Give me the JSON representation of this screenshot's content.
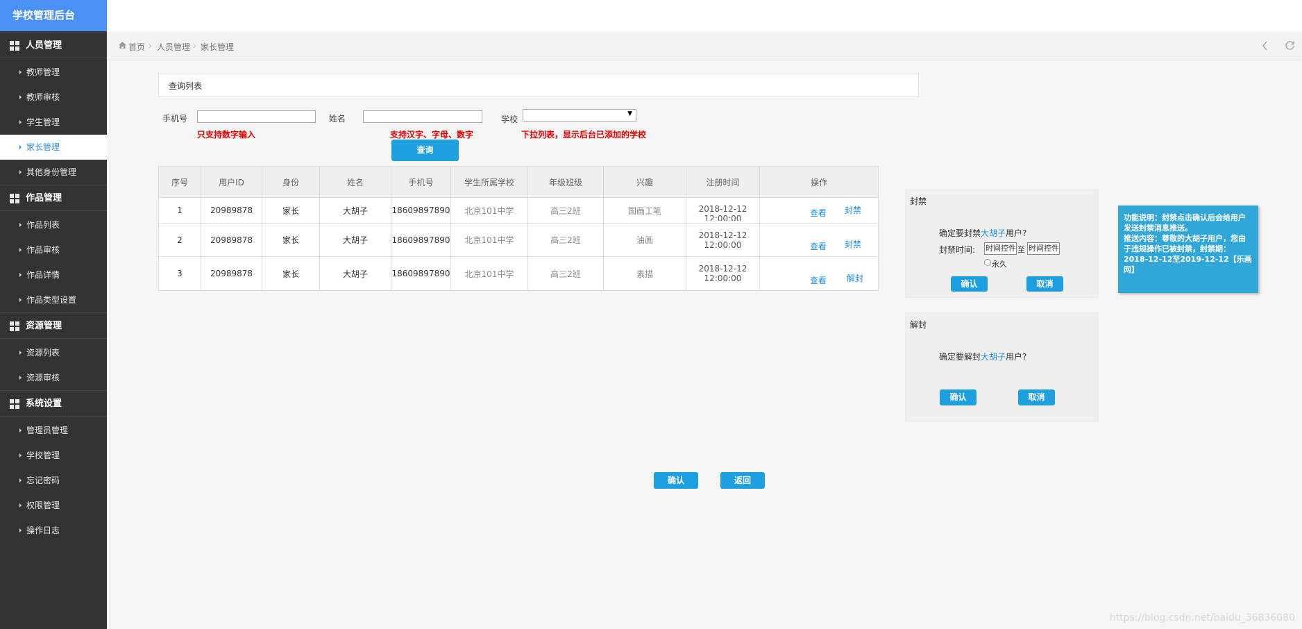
{
  "brand": "学校管理后台",
  "sidebar": {
    "groups": [
      {
        "label": "人员管理",
        "items": [
          "教师管理",
          "教师审核",
          "学生管理",
          "家长管理",
          "其他身份管理"
        ]
      },
      {
        "label": "作品管理",
        "items": [
          "作品列表",
          "作品审核",
          "作品详情",
          "作品类型设置"
        ]
      },
      {
        "label": "资源管理",
        "items": [
          "资源列表",
          "资源审核"
        ]
      },
      {
        "label": "系统设置",
        "items": [
          "管理员管理",
          "学校管理",
          "忘记密码",
          "权限管理",
          "操作日志"
        ]
      }
    ],
    "active_item": "家长管理"
  },
  "breadcrumb": {
    "home": "首页",
    "level1": "人员管理",
    "level2": "家长管理"
  },
  "query": {
    "title": "查询列表",
    "phone_label": "手机号",
    "name_label": "姓名",
    "school_label": "学校",
    "phone_hint": "只支持数字输入",
    "name_hint": "支持汉字、字母、数字",
    "school_hint": "下拉列表，显示后台已添加的学校",
    "search_button": "查询"
  },
  "table": {
    "headers": [
      "序号",
      "用户ID",
      "身份",
      "姓名",
      "手机号",
      "学生所属学校",
      "年级班级",
      "兴趣",
      "注册时间",
      "操作"
    ],
    "rows": [
      {
        "no": "1",
        "uid": "20989878",
        "role": "家长",
        "name": "大胡子",
        "phone": "18609897890",
        "school": "北京101中学",
        "grade": "高三2班",
        "hobby": "国画工笔",
        "date": "2018-12-12",
        "time": "12:00:00",
        "view": "查看",
        "action": "封禁"
      },
      {
        "no": "2",
        "uid": "20989878",
        "role": "家长",
        "name": "大胡子",
        "phone": "18609897890",
        "school": "北京101中学",
        "grade": "高三2班",
        "hobby": "油画",
        "date": "2018-12-12",
        "time": "12:00:00",
        "view": "查看",
        "action": "封禁"
      },
      {
        "no": "3",
        "uid": "20989878",
        "role": "家长",
        "name": "大胡子",
        "phone": "18609897890",
        "school": "北京101中学",
        "grade": "高三2班",
        "hobby": "素描",
        "date": "2018-12-12",
        "time": "12:00:00",
        "view": "查看",
        "action": "解封"
      }
    ]
  },
  "ban_dialog": {
    "title": "封禁",
    "confirm_pre": "确定要封禁",
    "user": "大胡子",
    "confirm_post": "用户?",
    "time_label": "封禁时间:",
    "start_placeholder": "时间控件",
    "to": "至",
    "end_placeholder": "时间控件",
    "forever": "永久",
    "ok": "确认",
    "cancel": "取消"
  },
  "unban_dialog": {
    "title": "解封",
    "confirm_pre": "确定要解封",
    "user": "大胡子",
    "confirm_post": "用户?",
    "ok": "确认",
    "cancel": "取消"
  },
  "note": {
    "line1": "功能说明：封禁点击确认后会给用户发送封禁消息推送。",
    "line2": "推送内容：尊敬的大胡子用户，您由于违规操作已被封禁，封禁期：2018-12-12至2019-12-12【乐画网】"
  },
  "bottom": {
    "ok": "确认",
    "back": "返回"
  },
  "watermark": "https://blog.csdn.net/baidu_36836080"
}
